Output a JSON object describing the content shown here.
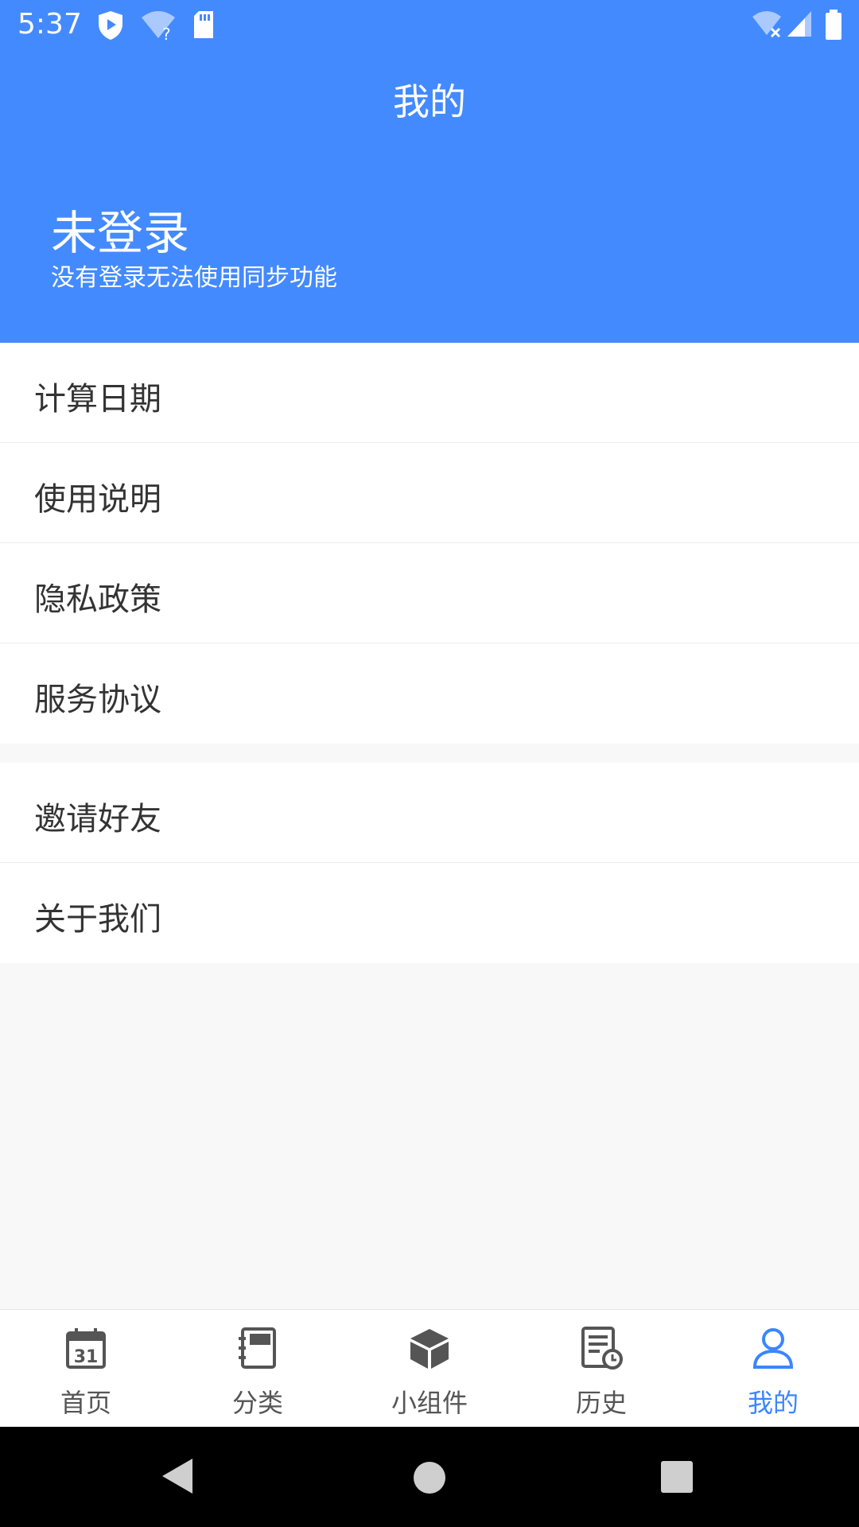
{
  "status_bar": {
    "time": "5:37",
    "icons": [
      "shield-icon",
      "wifi-question-icon",
      "sd-card-icon",
      "wifi-off-icon",
      "signal-icon",
      "battery-icon"
    ]
  },
  "header": {
    "title": "我的",
    "user_name": "未登录",
    "user_subtitle": "没有登录无法使用同步功能"
  },
  "menu_group_1": [
    {
      "label": "计算日期"
    },
    {
      "label": "使用说明"
    },
    {
      "label": "隐私政策"
    },
    {
      "label": "服务协议"
    }
  ],
  "menu_group_2": [
    {
      "label": "邀请好友"
    },
    {
      "label": "关于我们"
    }
  ],
  "bottom_nav": [
    {
      "label": "首页",
      "icon": "calendar-icon"
    },
    {
      "label": "分类",
      "icon": "notebook-icon"
    },
    {
      "label": "小组件",
      "icon": "cube-icon"
    },
    {
      "label": "历史",
      "icon": "history-icon"
    },
    {
      "label": "我的",
      "icon": "person-icon",
      "active": true
    }
  ],
  "colors": {
    "primary": "#448aff",
    "active_tab": "#3a86ff",
    "background": "#f8f8f8"
  }
}
